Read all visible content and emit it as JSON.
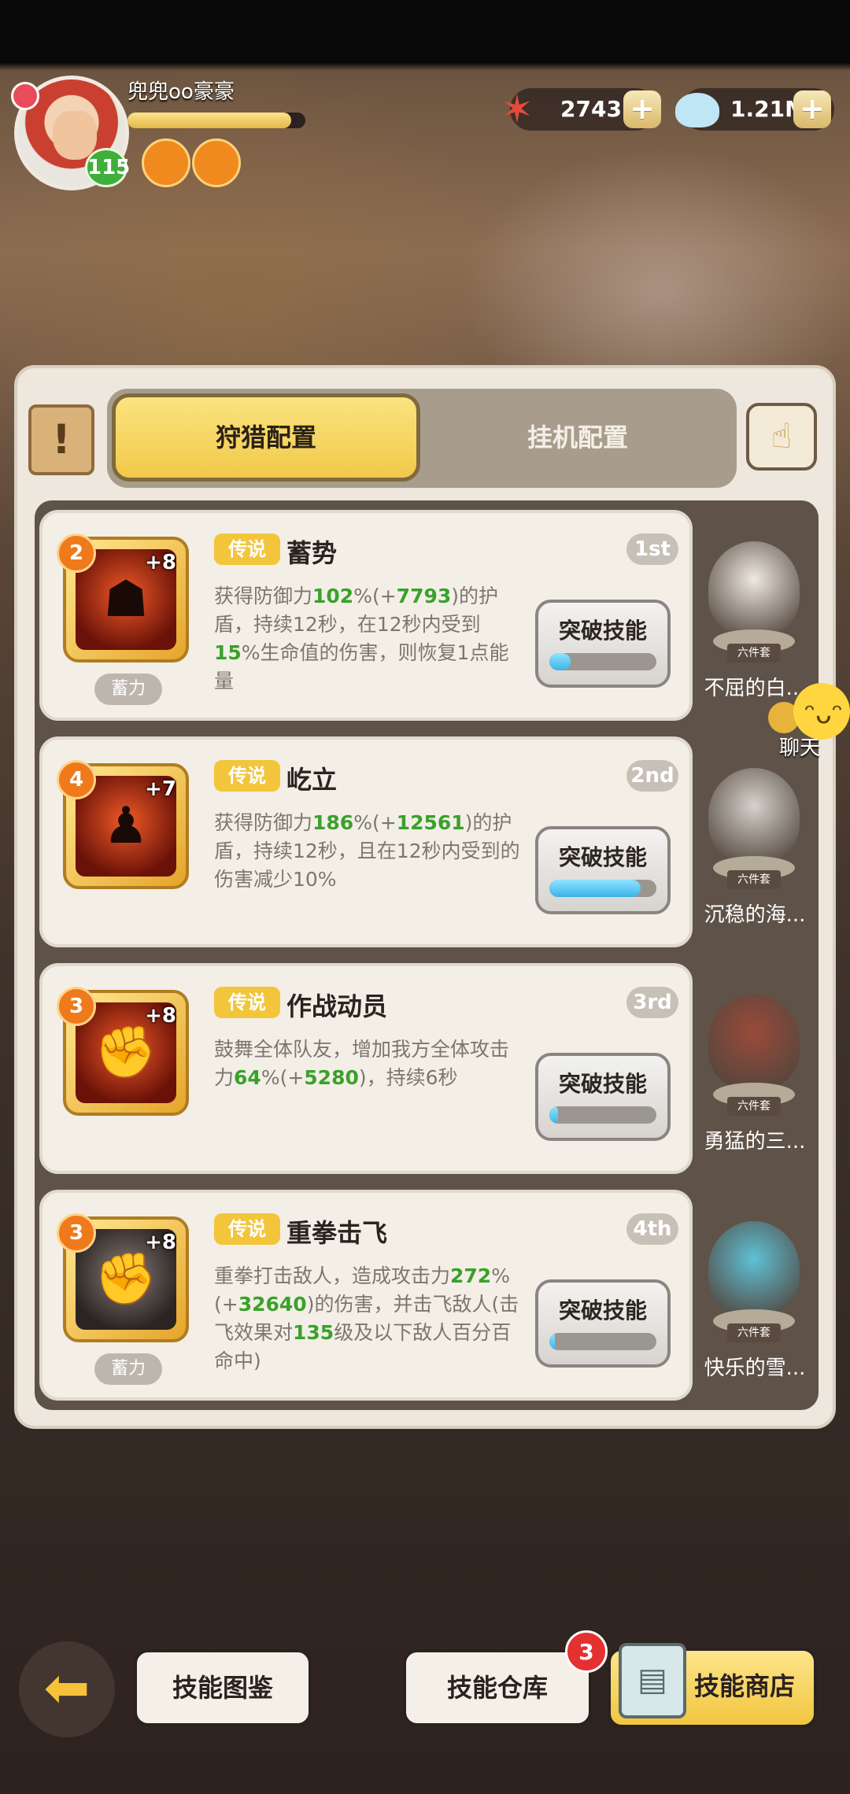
{
  "player": {
    "name": "兜兜oo豪豪",
    "level": "115",
    "xp_fraction": 0.92
  },
  "currencies": [
    {
      "name": "starfish",
      "value": "2743"
    },
    {
      "name": "shell",
      "value": "1.21M"
    }
  ],
  "tabs": {
    "active": "狩猎配置",
    "inactive": "挂机配置"
  },
  "skills": [
    {
      "level": "2",
      "plus": "+8",
      "rarity": "传说",
      "name": "蓄势",
      "rank": "1st",
      "desc": [
        {
          "t": "获得防御力"
        },
        {
          "t": "102",
          "g": true
        },
        {
          "t": "%(+"
        },
        {
          "t": "7793",
          "g": true
        },
        {
          "t": ")的护盾，持续12秒，在12秒内受到"
        },
        {
          "t": "15",
          "g": true
        },
        {
          "t": "%生命值的伤害，则恢复1点能量"
        }
      ],
      "charge": "蓄力",
      "button": "突破技能",
      "progress": 0.2
    },
    {
      "level": "4",
      "plus": "+7",
      "rarity": "传说",
      "name": "屹立",
      "rank": "2nd",
      "desc": [
        {
          "t": "获得防御力"
        },
        {
          "t": "186",
          "g": true
        },
        {
          "t": "%(+"
        },
        {
          "t": "12561",
          "g": true
        },
        {
          "t": ")的护盾，持续12秒，且在12秒内受到的伤害减少10%"
        }
      ],
      "charge": "",
      "button": "突破技能",
      "progress": 0.85
    },
    {
      "level": "3",
      "plus": "+8",
      "rarity": "传说",
      "name": "作战动员",
      "rank": "3rd",
      "desc": [
        {
          "t": "鼓舞全体队友，增加我方全体攻击力"
        },
        {
          "t": "64",
          "g": true
        },
        {
          "t": "%(+"
        },
        {
          "t": "5280",
          "g": true
        },
        {
          "t": ")，持续6秒"
        }
      ],
      "charge": "",
      "button": "突破技能",
      "progress": 0.08
    },
    {
      "level": "3",
      "plus": "+8",
      "rarity": "传说",
      "name": "重拳击飞",
      "rank": "4th",
      "desc": [
        {
          "t": "重拳打击敌人，造成攻击力"
        },
        {
          "t": "272",
          "g": true
        },
        {
          "t": "%(+"
        },
        {
          "t": "32640",
          "g": true
        },
        {
          "t": ")的伤害，并击飞敌人(击飞效果对"
        },
        {
          "t": "135",
          "g": true
        },
        {
          "t": "级及以下敌人百分百命中)"
        }
      ],
      "charge": "蓄力",
      "button": "突破技能",
      "progress": 0.05
    }
  ],
  "sets": [
    {
      "name": "不屈的白...",
      "tag": "六件套",
      "color": "#efe9e2"
    },
    {
      "name": "沉稳的海...",
      "tag": "六件套",
      "color": "#d6d2cc"
    },
    {
      "name": "勇猛的三...",
      "tag": "六件套",
      "color": "#9a4a3a"
    },
    {
      "name": "快乐的雪...",
      "tag": "六件套",
      "color": "#5fc1d6"
    }
  ],
  "chat": {
    "label": "聊天"
  },
  "bottom": {
    "codex": "技能图鉴",
    "warehouse": "技能仓库",
    "warehouse_badge": "3",
    "shop": "技能商店"
  },
  "colors": {
    "accent": "#f3c53b",
    "highlight_green": "#3aa12b",
    "progress_blue": "#3cb3ea"
  }
}
